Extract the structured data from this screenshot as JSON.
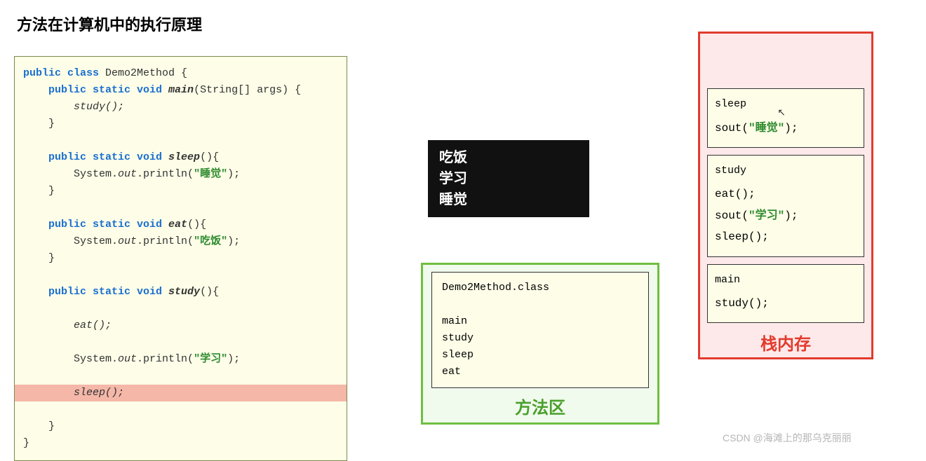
{
  "title": "方法在计算机中的执行原理",
  "code": {
    "l1a": "public",
    "l1b": " class",
    "l1c": " Demo2Method {",
    "l2a": "    public",
    "l2b": " static",
    "l2c": " void",
    "l2d": " main",
    "l2e": "(String[] args) {",
    "l3": "        study();",
    "l4": "    }",
    "l6a": "    public",
    "l6b": " static",
    "l6c": " void",
    "l6d": " sleep",
    "l6e": "(){",
    "l7a": "        System.",
    "l7b": "out",
    "l7c": ".println(",
    "l7d": "\"睡觉\"",
    "l7e": ");",
    "l8": "    }",
    "l10a": "    public",
    "l10b": " static",
    "l10c": " void",
    "l10d": " eat",
    "l10e": "(){",
    "l11a": "        System.",
    "l11b": "out",
    "l11c": ".println(",
    "l11d": "\"吃饭\"",
    "l11e": ");",
    "l12": "    }",
    "l14a": "    public",
    "l14b": " static",
    "l14c": " void",
    "l14d": " study",
    "l14e": "(){",
    "l16": "        eat();",
    "l18a": "        System.",
    "l18b": "out",
    "l18c": ".println(",
    "l18d": "\"学习\"",
    "l18e": ");",
    "l20": "        sleep();",
    "l22": "    }",
    "l23": "}"
  },
  "console": {
    "line1": "吃饭",
    "line2": "学习",
    "line3": "睡觉"
  },
  "methodArea": {
    "file": "Demo2Method.class",
    "m1": "main",
    "m2": "study",
    "m3": "sleep",
    "m4": "eat",
    "label": "方法区"
  },
  "stack": {
    "label": "栈内存",
    "frame1": {
      "name": "sleep",
      "body1a": "sout(",
      "body1s": "\"睡觉\"",
      "body1b": ");"
    },
    "frame2": {
      "name": "study",
      "b1": "eat();",
      "b2a": "sout(",
      "b2s": "\"学习\"",
      "b2b": ");",
      "b3": "sleep();"
    },
    "frame3": {
      "name": "main",
      "b1": "study();"
    }
  },
  "watermark": "CSDN @海滩上的那乌克丽丽"
}
